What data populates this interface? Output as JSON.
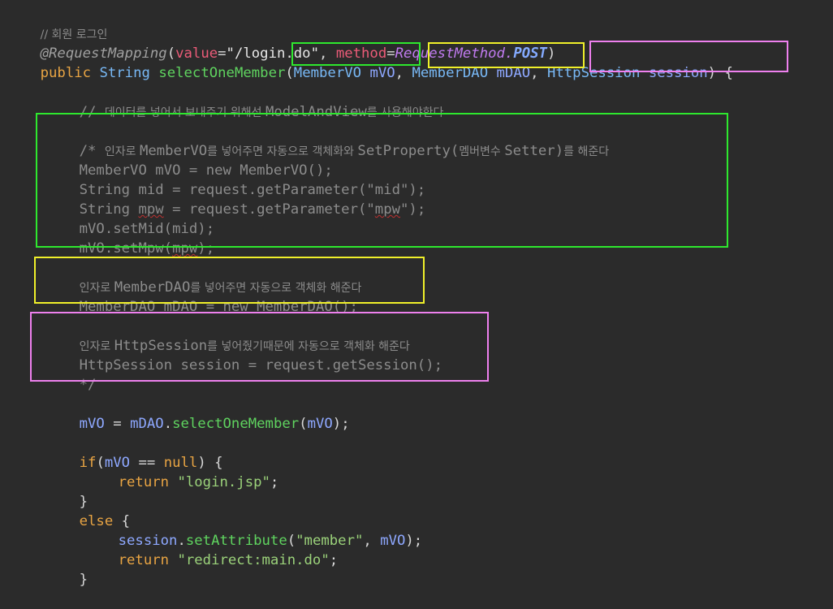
{
  "code": {
    "l1": "// 회원 로그인",
    "l2": {
      "annotation": "@RequestMapping",
      "open": "(",
      "value_key": "value",
      "eq": "=",
      "path": "\"/login.do\"",
      "comma": ", ",
      "method_key": "method",
      "eq2": "=",
      "enum_type": "RequestMethod",
      "dot": ".",
      "enum_const": "POST",
      "close": ")"
    },
    "l3": {
      "public": "public",
      "sp1": " ",
      "string": "String",
      "sp2": " ",
      "method": "selectOneMember",
      "open": "(",
      "p1_type": "MemberVO",
      "p1_sp": " ",
      "p1_name": "mVO",
      "comma1": ", ",
      "p2_type": "MemberDAO",
      "p2_sp": " ",
      "p2_name": "mDAO",
      "comma2": ", ",
      "p3_type": "HttpSession",
      "p3_sp": " ",
      "p3_name": "session",
      "close": ") {"
    },
    "l4": {
      "prefix": "// ",
      "ko1": "데이터를 넣어서 보내주기 위해선 ",
      "cls": "ModelAndView",
      "ko2": "를 사용해야한다"
    },
    "c1": {
      "prefix": "/* ",
      "ko1": "인자로 ",
      "cls1": "MemberVO",
      "ko2": "를 넣어주면 자동으로 객체화와 ",
      "cls2": "SetProperty(",
      "ko3": "멤버변수 ",
      "cls3": "Setter)",
      "ko4": "를 해준다"
    },
    "c2": "MemberVO mVO = new MemberVO();",
    "c3": "String mid = request.getParameter(\"mid\");",
    "c4": {
      "pre": "String ",
      "sq": "mpw",
      "mid": " = request.getParameter(\"",
      "sq2": "mpw",
      "post": "\");"
    },
    "c5": "mVO.setMid(mid);",
    "c6": {
      "pre": "mVO.setMpw(",
      "sq": "mpw",
      "post": ");"
    },
    "c7": {
      "ko1": "인자로 ",
      "cls": "MemberDAO",
      "ko2": "를 넣어주면 자동으로 객체화 해준다"
    },
    "c8": "MemberDAO mDAO = new MemberDAO();",
    "c9": {
      "ko1": "인자로 ",
      "cls": "HttpSession",
      "ko2": "를 넣어줬기때문에 자동으로 객체화 해준다"
    },
    "c10": "HttpSession session = request.getSession();",
    "c11": "*/",
    "l5": {
      "v1": "mVO",
      "eq": " = ",
      "v2": "mDAO",
      "dot": ".",
      "m": "selectOneMember",
      "open": "(",
      "arg": "mVO",
      "close": ");"
    },
    "l6": {
      "kw": "if",
      "open": "(",
      "v": "mVO",
      "op": " == ",
      "nl": "null",
      "close": ") {"
    },
    "l7": {
      "kw": "return",
      "sp": " ",
      "str": "\"login.jsp\"",
      "end": ";"
    },
    "l8": "}",
    "l9": {
      "kw": "else",
      "brace": " {"
    },
    "l10": {
      "v": "session",
      "dot": ".",
      "m": "setAttribute",
      "open": "(",
      "str": "\"member\"",
      "comma": ", ",
      "arg": "mVO",
      "close": ");"
    },
    "l11": {
      "kw": "return",
      "sp": " ",
      "str": "\"redirect:main.do\"",
      "end": ";"
    },
    "l12": "}"
  }
}
